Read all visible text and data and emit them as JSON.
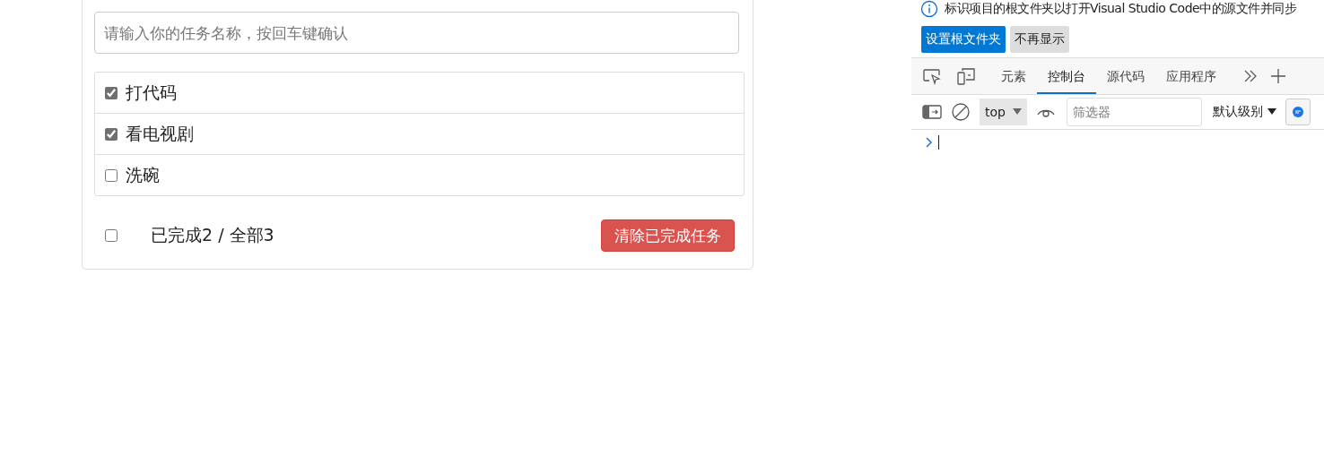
{
  "todo": {
    "input": {
      "placeholder": "请输入你的任务名称，按回车键确认"
    },
    "tasks": [
      {
        "name": "打代码",
        "done": true
      },
      {
        "name": "看电视剧",
        "done": true
      },
      {
        "name": "洗碗",
        "done": false
      }
    ],
    "footer": {
      "select_all": false,
      "summary": "已完成2 / 全部3",
      "clear_button": "清除已完成任务"
    }
  },
  "devtools": {
    "notice": {
      "text": "标识项目的根文件夹以打开Visual Studio Code中的源文件并同步",
      "buttons": [
        {
          "label": "设置根文件夹",
          "kind": "primary"
        },
        {
          "label": "不再显示",
          "kind": "secondary"
        }
      ]
    },
    "tabs": [
      {
        "label": "元素",
        "selected": false
      },
      {
        "label": "控制台",
        "selected": true
      },
      {
        "label": "源代码",
        "selected": false
      },
      {
        "label": "应用程序",
        "selected": false
      }
    ],
    "toolbar": {
      "context": "top",
      "filter": {
        "placeholder": "筛选器"
      },
      "levels": "默认级别"
    }
  }
}
